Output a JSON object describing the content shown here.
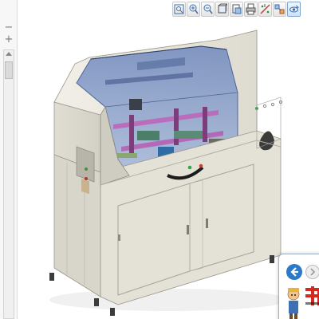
{
  "window": {
    "background": "#ffffff"
  },
  "toolbar": {
    "buttons": [
      {
        "icon": "zoom-fit-icon"
      },
      {
        "icon": "zoom-in-icon"
      },
      {
        "icon": "zoom-out-icon"
      },
      {
        "icon": "view-cube-icon"
      },
      {
        "icon": "section-view-icon"
      },
      {
        "icon": "print-icon"
      },
      {
        "icon": "measure-icon"
      },
      {
        "icon": "explode-icon"
      },
      {
        "icon": "orbit-icon",
        "active": true
      }
    ]
  },
  "sidebar": {
    "expand_symbol": "+",
    "collapse_symbol": "−",
    "add_symbol": "+"
  },
  "model": {
    "body_color": "#e9e7dd",
    "cover_color": "#8fa6cf",
    "frame_accent": "#c062b8",
    "window_slot_color": "#c9b28e"
  },
  "popup": {
    "back_icon": "arrow-left-icon",
    "next_icon": "arrow-right-icon",
    "logo_icon": "brand-logo-icon",
    "avatar_icon": "mascot-avatar-icon",
    "accent_color": "#2c79c7"
  }
}
